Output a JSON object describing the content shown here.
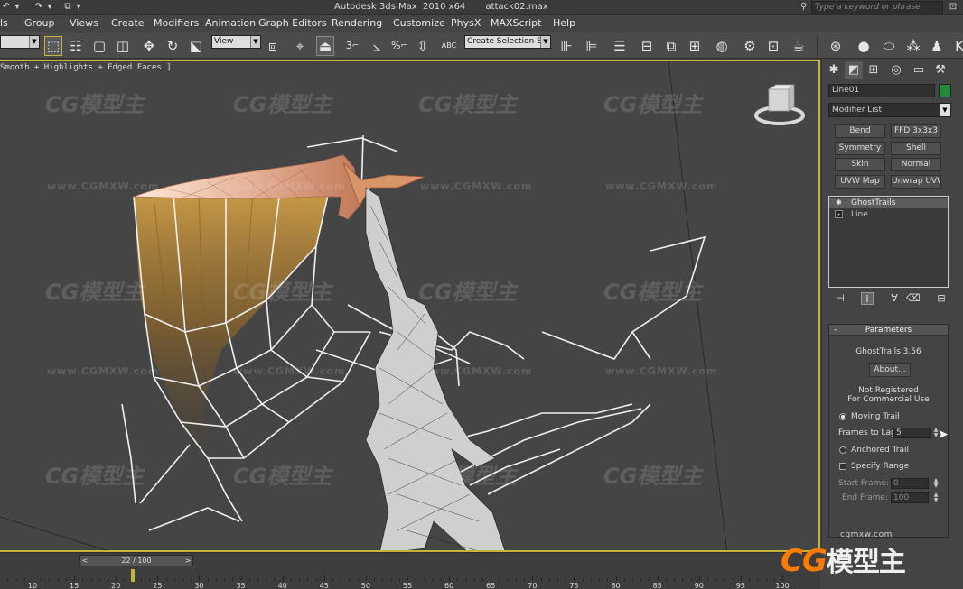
{
  "titlebar": {
    "title": "Autodesk 3ds Max  2010 x64       attack02.max",
    "search_placeholder": "Type a keyword or phrase",
    "search_icon": "binoculars-icon",
    "help_icon": "help-icon"
  },
  "menu": [
    "ls",
    "Group",
    "Views",
    "Create",
    "Modifiers",
    "Animation",
    "Graph Editors",
    "Rendering",
    "Customize",
    "PhysX",
    "MAXScript",
    "Help"
  ],
  "toolbar": {
    "selection_filter": "",
    "reference_coord": "View",
    "named_selection": "Create Selection Se",
    "snap_label_3": "3",
    "snap_label_percent": "%",
    "abc_label": "ABC"
  },
  "viewport": {
    "label": "Smooth + Highlights + Edged Faces ]",
    "border_color": "#c8b33a",
    "watermark_logo": "CG模型主",
    "watermark_url": "www.CGMXW.com"
  },
  "command_panel": {
    "tabs": [
      "create-icon",
      "modify-icon",
      "hierarchy-icon",
      "motion-icon",
      "display-icon",
      "utilities-icon"
    ],
    "object_name": "Line01",
    "object_color": "#1f8a3c",
    "modifier_list": "Modifier List",
    "modifier_buttons": [
      "Bend",
      "FFD 3x3x3",
      "Symmetry",
      "Shell",
      "Skin",
      "Normal",
      "UVW Map",
      "Unwrap UVW"
    ],
    "stack": [
      {
        "label": "GhostTrails",
        "selected": true
      },
      {
        "label": "Line",
        "selected": false
      }
    ],
    "parameters": {
      "header": "Parameters",
      "version": "GhostTrails 3.56",
      "about": "About...",
      "reg1": "Not Registered",
      "reg2": "For Commercial Use",
      "moving_trail": "Moving Trail",
      "frames_to_lag_label": "Frames to Lag:",
      "frames_to_lag": "5",
      "anchored_trail": "Anchored Trail",
      "specify_range": "Specify Range",
      "start_frame_label": "Start Frame:",
      "start_frame": "0",
      "end_frame_label": "End Frame:",
      "end_frame": "100"
    }
  },
  "timeline": {
    "frame_display": "22 / 100",
    "current_frame": 22,
    "ticks": [
      "10",
      "15",
      "20",
      "25",
      "30",
      "35",
      "40",
      "45",
      "50",
      "55",
      "60",
      "65",
      "70",
      "75",
      "80",
      "85",
      "90",
      "95",
      "100"
    ]
  },
  "branding": {
    "url": "cgmxw.com",
    "logo_cg": "CG",
    "logo_cn": "模型主"
  }
}
